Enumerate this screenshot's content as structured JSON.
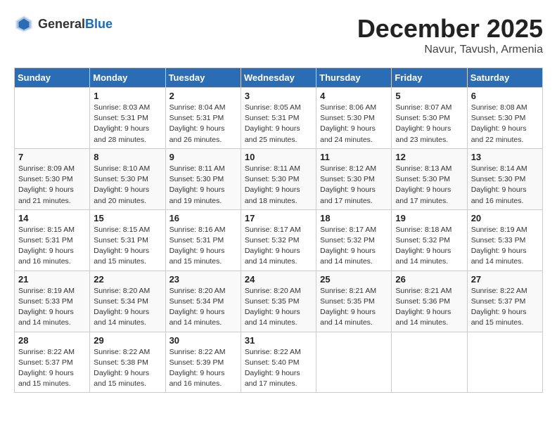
{
  "header": {
    "logo_general": "General",
    "logo_blue": "Blue",
    "month": "December 2025",
    "location": "Navur, Tavush, Armenia"
  },
  "days_of_week": [
    "Sunday",
    "Monday",
    "Tuesday",
    "Wednesday",
    "Thursday",
    "Friday",
    "Saturday"
  ],
  "weeks": [
    [
      {
        "day": "",
        "sunrise": "",
        "sunset": "",
        "daylight": ""
      },
      {
        "day": "1",
        "sunrise": "Sunrise: 8:03 AM",
        "sunset": "Sunset: 5:31 PM",
        "daylight": "Daylight: 9 hours and 28 minutes."
      },
      {
        "day": "2",
        "sunrise": "Sunrise: 8:04 AM",
        "sunset": "Sunset: 5:31 PM",
        "daylight": "Daylight: 9 hours and 26 minutes."
      },
      {
        "day": "3",
        "sunrise": "Sunrise: 8:05 AM",
        "sunset": "Sunset: 5:31 PM",
        "daylight": "Daylight: 9 hours and 25 minutes."
      },
      {
        "day": "4",
        "sunrise": "Sunrise: 8:06 AM",
        "sunset": "Sunset: 5:30 PM",
        "daylight": "Daylight: 9 hours and 24 minutes."
      },
      {
        "day": "5",
        "sunrise": "Sunrise: 8:07 AM",
        "sunset": "Sunset: 5:30 PM",
        "daylight": "Daylight: 9 hours and 23 minutes."
      },
      {
        "day": "6",
        "sunrise": "Sunrise: 8:08 AM",
        "sunset": "Sunset: 5:30 PM",
        "daylight": "Daylight: 9 hours and 22 minutes."
      }
    ],
    [
      {
        "day": "7",
        "sunrise": "Sunrise: 8:09 AM",
        "sunset": "Sunset: 5:30 PM",
        "daylight": "Daylight: 9 hours and 21 minutes."
      },
      {
        "day": "8",
        "sunrise": "Sunrise: 8:10 AM",
        "sunset": "Sunset: 5:30 PM",
        "daylight": "Daylight: 9 hours and 20 minutes."
      },
      {
        "day": "9",
        "sunrise": "Sunrise: 8:11 AM",
        "sunset": "Sunset: 5:30 PM",
        "daylight": "Daylight: 9 hours and 19 minutes."
      },
      {
        "day": "10",
        "sunrise": "Sunrise: 8:11 AM",
        "sunset": "Sunset: 5:30 PM",
        "daylight": "Daylight: 9 hours and 18 minutes."
      },
      {
        "day": "11",
        "sunrise": "Sunrise: 8:12 AM",
        "sunset": "Sunset: 5:30 PM",
        "daylight": "Daylight: 9 hours and 17 minutes."
      },
      {
        "day": "12",
        "sunrise": "Sunrise: 8:13 AM",
        "sunset": "Sunset: 5:30 PM",
        "daylight": "Daylight: 9 hours and 17 minutes."
      },
      {
        "day": "13",
        "sunrise": "Sunrise: 8:14 AM",
        "sunset": "Sunset: 5:30 PM",
        "daylight": "Daylight: 9 hours and 16 minutes."
      }
    ],
    [
      {
        "day": "14",
        "sunrise": "Sunrise: 8:15 AM",
        "sunset": "Sunset: 5:31 PM",
        "daylight": "Daylight: 9 hours and 16 minutes."
      },
      {
        "day": "15",
        "sunrise": "Sunrise: 8:15 AM",
        "sunset": "Sunset: 5:31 PM",
        "daylight": "Daylight: 9 hours and 15 minutes."
      },
      {
        "day": "16",
        "sunrise": "Sunrise: 8:16 AM",
        "sunset": "Sunset: 5:31 PM",
        "daylight": "Daylight: 9 hours and 15 minutes."
      },
      {
        "day": "17",
        "sunrise": "Sunrise: 8:17 AM",
        "sunset": "Sunset: 5:32 PM",
        "daylight": "Daylight: 9 hours and 14 minutes."
      },
      {
        "day": "18",
        "sunrise": "Sunrise: 8:17 AM",
        "sunset": "Sunset: 5:32 PM",
        "daylight": "Daylight: 9 hours and 14 minutes."
      },
      {
        "day": "19",
        "sunrise": "Sunrise: 8:18 AM",
        "sunset": "Sunset: 5:32 PM",
        "daylight": "Daylight: 9 hours and 14 minutes."
      },
      {
        "day": "20",
        "sunrise": "Sunrise: 8:19 AM",
        "sunset": "Sunset: 5:33 PM",
        "daylight": "Daylight: 9 hours and 14 minutes."
      }
    ],
    [
      {
        "day": "21",
        "sunrise": "Sunrise: 8:19 AM",
        "sunset": "Sunset: 5:33 PM",
        "daylight": "Daylight: 9 hours and 14 minutes."
      },
      {
        "day": "22",
        "sunrise": "Sunrise: 8:20 AM",
        "sunset": "Sunset: 5:34 PM",
        "daylight": "Daylight: 9 hours and 14 minutes."
      },
      {
        "day": "23",
        "sunrise": "Sunrise: 8:20 AM",
        "sunset": "Sunset: 5:34 PM",
        "daylight": "Daylight: 9 hours and 14 minutes."
      },
      {
        "day": "24",
        "sunrise": "Sunrise: 8:20 AM",
        "sunset": "Sunset: 5:35 PM",
        "daylight": "Daylight: 9 hours and 14 minutes."
      },
      {
        "day": "25",
        "sunrise": "Sunrise: 8:21 AM",
        "sunset": "Sunset: 5:35 PM",
        "daylight": "Daylight: 9 hours and 14 minutes."
      },
      {
        "day": "26",
        "sunrise": "Sunrise: 8:21 AM",
        "sunset": "Sunset: 5:36 PM",
        "daylight": "Daylight: 9 hours and 14 minutes."
      },
      {
        "day": "27",
        "sunrise": "Sunrise: 8:22 AM",
        "sunset": "Sunset: 5:37 PM",
        "daylight": "Daylight: 9 hours and 15 minutes."
      }
    ],
    [
      {
        "day": "28",
        "sunrise": "Sunrise: 8:22 AM",
        "sunset": "Sunset: 5:37 PM",
        "daylight": "Daylight: 9 hours and 15 minutes."
      },
      {
        "day": "29",
        "sunrise": "Sunrise: 8:22 AM",
        "sunset": "Sunset: 5:38 PM",
        "daylight": "Daylight: 9 hours and 15 minutes."
      },
      {
        "day": "30",
        "sunrise": "Sunrise: 8:22 AM",
        "sunset": "Sunset: 5:39 PM",
        "daylight": "Daylight: 9 hours and 16 minutes."
      },
      {
        "day": "31",
        "sunrise": "Sunrise: 8:22 AM",
        "sunset": "Sunset: 5:40 PM",
        "daylight": "Daylight: 9 hours and 17 minutes."
      },
      {
        "day": "",
        "sunrise": "",
        "sunset": "",
        "daylight": ""
      },
      {
        "day": "",
        "sunrise": "",
        "sunset": "",
        "daylight": ""
      },
      {
        "day": "",
        "sunrise": "",
        "sunset": "",
        "daylight": ""
      }
    ]
  ]
}
